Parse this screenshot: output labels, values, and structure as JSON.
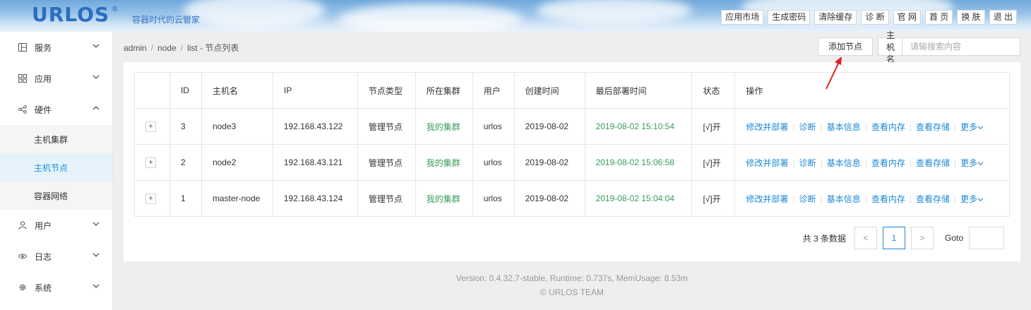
{
  "header": {
    "logo": "URLOS",
    "logo_mark": "®",
    "slogan": "容器时代的云管家",
    "nav": [
      "应用市场",
      "生成密码",
      "清除缓存",
      "诊 断",
      "官 网",
      "首 页",
      "换 肤",
      "退 出"
    ]
  },
  "sidebar": {
    "items": [
      {
        "label": "服务",
        "icon": "grid-layout-icon"
      },
      {
        "label": "应用",
        "icon": "apps-icon"
      },
      {
        "label": "硬件",
        "icon": "share-nodes-icon"
      },
      {
        "label": "用户",
        "icon": "user-icon"
      },
      {
        "label": "日志",
        "icon": "eye-icon"
      },
      {
        "label": "系统",
        "icon": "gear-icon"
      }
    ],
    "hardware_sub": [
      "主机集群",
      "主机节点",
      "容器网络"
    ]
  },
  "breadcrumb": {
    "parts": [
      "admin",
      "node",
      "list"
    ],
    "current": "节点列表"
  },
  "toolbar": {
    "add_label": "添加节点",
    "search_field": "主机名",
    "search_placeholder": "请输搜索内容"
  },
  "table": {
    "headers": [
      "",
      "ID",
      "主机名",
      "IP",
      "节点类型",
      "所在集群",
      "用户",
      "创建时间",
      "最后部署时间",
      "状态",
      "操作"
    ],
    "rows": [
      {
        "expand": "+",
        "id": "3",
        "host": "node3",
        "ip": "192.168.43.122",
        "type": "管理节点",
        "cluster": "我的集群",
        "user": "urlos",
        "created": "2019-08-02",
        "deployed": "2019-08-02 15:10:54",
        "status": "[√]开"
      },
      {
        "expand": "+",
        "id": "2",
        "host": "node2",
        "ip": "192.168.43.121",
        "type": "管理节点",
        "cluster": "我的集群",
        "user": "urlos",
        "created": "2019-08-02",
        "deployed": "2019-08-02 15:06:58",
        "status": "[√]开"
      },
      {
        "expand": "+",
        "id": "1",
        "host": "master-node",
        "ip": "192.168.43.124",
        "type": "管理节点",
        "cluster": "我的集群",
        "user": "urlos",
        "created": "2019-08-02",
        "deployed": "2019-08-02 15:04:04",
        "status": "[√]开"
      }
    ],
    "ops": [
      "修改并部署",
      "诊断",
      "基本信息",
      "查看内存",
      "查看存储",
      "更多"
    ]
  },
  "pagination": {
    "total": "共 3 条数据",
    "prev": "<",
    "current": "1",
    "next": ">",
    "goto": "Goto"
  },
  "footer": {
    "line1": "Version: 0.4.32.7-stable,   Runtime: 0.737s,   MemUsage: 8.53m",
    "line2": "© URLOS TEAM"
  },
  "colors": {
    "accent": "#1e88d8",
    "green": "#3a9d5a",
    "annotation": "#e02020"
  }
}
